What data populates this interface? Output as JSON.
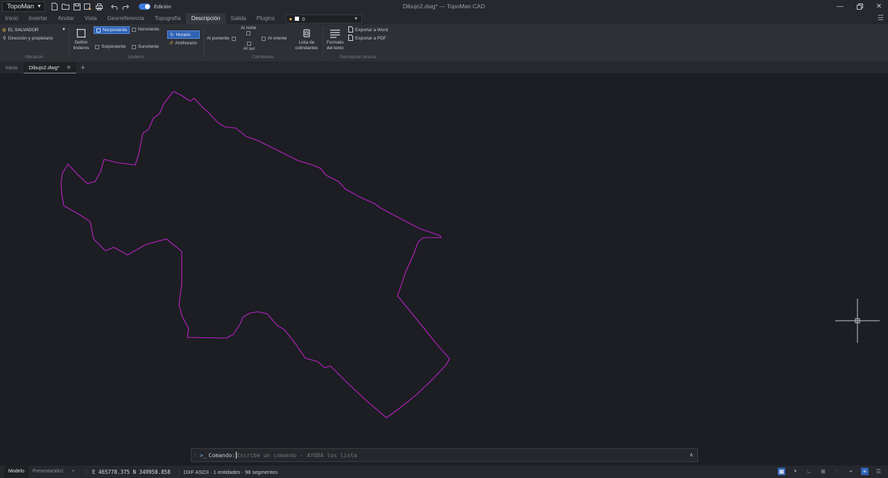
{
  "app": {
    "menu_label": "TopoMan",
    "window_title": "Dibujo2.dwg* — TopoMan CAD",
    "edit_toggle_label": "Edición"
  },
  "ribbon_tabs": [
    "Inicio",
    "Insertar",
    "Anotar",
    "Vista",
    "Georreferencia",
    "Topografía",
    "Descripción",
    "Salida",
    "Plugins"
  ],
  "active_ribbon_tab": "Descripción",
  "layer": {
    "name": "0",
    "color": "#ffffff"
  },
  "ribbon": {
    "ubicacion": {
      "country": "EL SALVADOR",
      "address_label": "Dirección y propietario",
      "group_label": "Ubicación"
    },
    "linderos": {
      "define_label_1": "Definir",
      "define_label_2": "linderos",
      "norponiente": "Norponiente",
      "nororiente": "Nororiente",
      "surponiente": "Surponiente",
      "suroriente": "Suroriente",
      "horario": "Horario",
      "antihorario": "Antihorario",
      "group_label": "Linderos"
    },
    "colindantes": {
      "al_norte": "Al norte",
      "al_poniente": "Al poniente",
      "al_oriente": "Al oriente",
      "al_sur": "Al sur",
      "lista_1": "Lista de",
      "lista_2": "colindantes",
      "group_label": "Colindantes"
    },
    "descripcion": {
      "formato_1": "Formato",
      "formato_2": "del texto",
      "export_word": "Exportar a Word",
      "export_pdf": "Exportar a PDF",
      "group_label": "Descripción técnica"
    }
  },
  "doc_tabs": {
    "home": "Inicio",
    "current": "Dibujo2.dwg*"
  },
  "drawing": {
    "polyline_color": "#c020c8",
    "cursor_color": "#c8cbd0"
  },
  "command": {
    "label": "Comando:",
    "placeholder": "Escribe un comando · AYUDA los lista"
  },
  "status": {
    "model_tab": "Modelo",
    "layout_tab": "Presentación1",
    "add": "+",
    "coordinates": "E 465778.375 N 349958.858",
    "info": "DXF ASCII · 1 entidades · 98 segmentos"
  }
}
